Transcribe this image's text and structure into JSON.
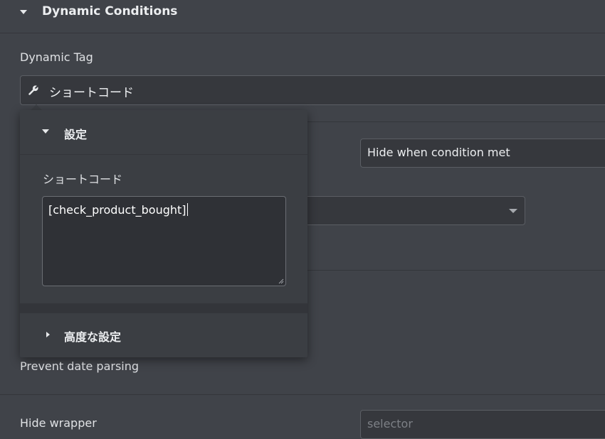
{
  "section": {
    "title": "Dynamic Conditions"
  },
  "dynamic_tag": {
    "label": "Dynamic Tag",
    "value": "ショートコード"
  },
  "popover": {
    "settings_header": "設定",
    "shortcode_label": "ショートコード",
    "shortcode_value": "[check_product_bought]",
    "advanced_header": "高度な設定"
  },
  "condition_action": {
    "value": "Hide when condition met"
  },
  "prevent_date_parsing": {
    "label": "Prevent date parsing"
  },
  "hide_wrapper": {
    "label": "Hide wrapper",
    "placeholder": "selector"
  }
}
